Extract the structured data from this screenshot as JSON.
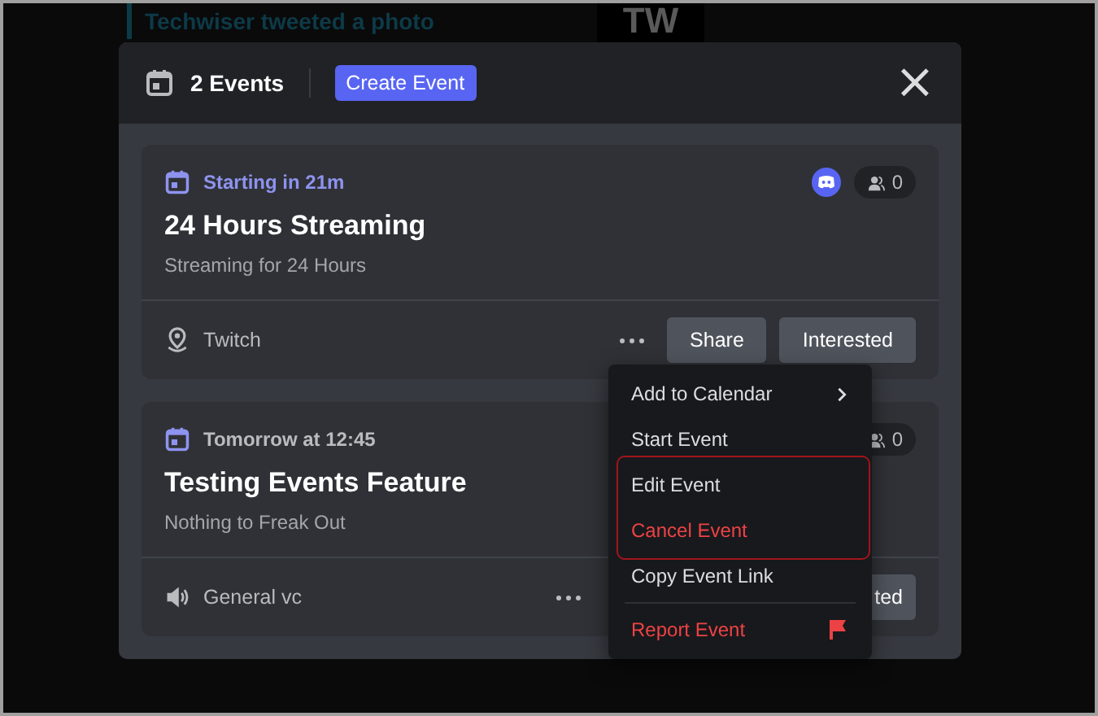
{
  "background": {
    "post_text": "Techwiser tweeted a photo",
    "logo_text": "TW"
  },
  "modal": {
    "title": "2 Events",
    "create_button": "Create Event",
    "close": "×"
  },
  "events": [
    {
      "when": "Starting in 21m",
      "live_soon": true,
      "title": "24 Hours Streaming",
      "description": "Streaming for 24 Hours",
      "location": "Twitch",
      "kind": "external",
      "attendees": "0",
      "host_badge": true,
      "share_button": "Share",
      "interest_button": "Interested"
    },
    {
      "when": "Tomorrow at 12:45",
      "live_soon": false,
      "title": "Testing Events Feature",
      "description": "Nothing to Freak Out",
      "location": "General vc",
      "kind": "voice",
      "attendees": "0",
      "interest_button": "ted"
    }
  ],
  "context_menu": {
    "items": [
      {
        "label": "Add to Calendar",
        "kind": "submenu",
        "danger": false,
        "highlighted": false
      },
      {
        "label": "Start Event",
        "kind": "plain",
        "danger": false,
        "highlighted": false
      },
      {
        "label": "Edit Event",
        "kind": "plain",
        "danger": false,
        "highlighted": true
      },
      {
        "label": "Cancel Event",
        "kind": "plain",
        "danger": true,
        "highlighted": true
      },
      {
        "label": "Copy Event Link",
        "kind": "plain",
        "danger": false,
        "highlighted": false
      },
      {
        "label": "Report Event",
        "kind": "flag",
        "danger": true,
        "highlighted": false
      }
    ]
  }
}
